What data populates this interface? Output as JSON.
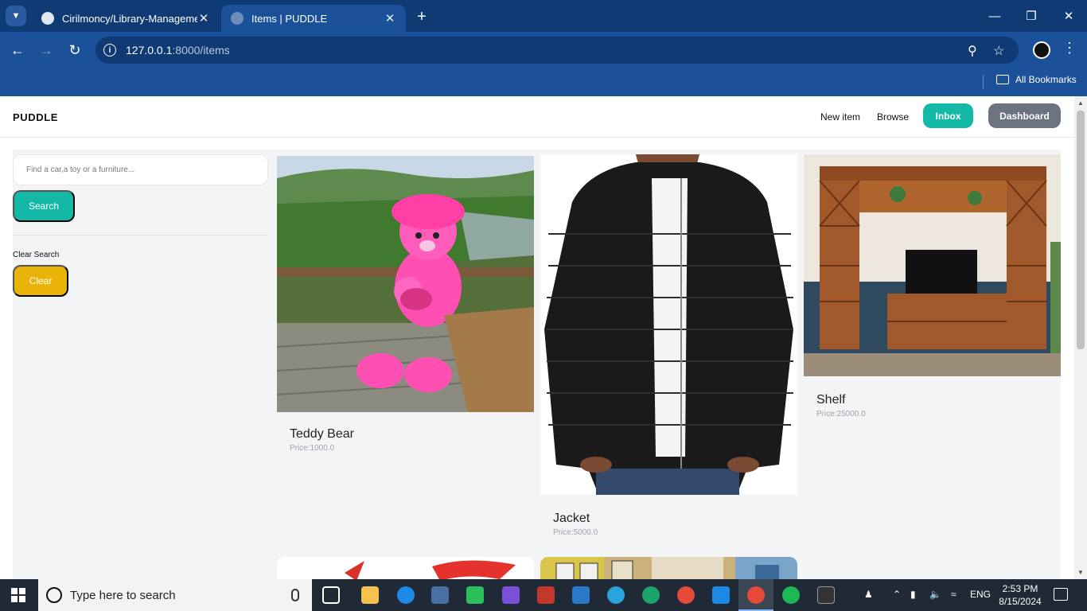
{
  "browser": {
    "tabs": [
      {
        "title": "Cirilmoncy/Library-Management",
        "active": false
      },
      {
        "title": "Items | PUDDLE",
        "active": true
      }
    ],
    "url_host": "127.0.0.1",
    "url_path": ":8000/items",
    "bookmarks_label": "All Bookmarks"
  },
  "navbar": {
    "brand": "PUDDLE",
    "new_item": "New item",
    "browse": "Browse",
    "inbox": "Inbox",
    "dashboard": "Dashboard"
  },
  "sidebar": {
    "search_placeholder": "Find a car,a toy or a furniture...",
    "search_button": "Search",
    "clear_label": "Clear Search",
    "clear_button": "Clear"
  },
  "items": [
    {
      "name": "Teddy Bear",
      "price": "Price:1000.0"
    },
    {
      "name": "Jacket",
      "price": "Price:5000.0"
    },
    {
      "name": "Shelf",
      "price": "Price:25000.0"
    }
  ],
  "taskbar": {
    "search_text": "Type here to search",
    "language": "ENG",
    "time": "2:53 PM",
    "date": "8/15/2024"
  },
  "colors": {
    "accent_teal": "#14b8a6",
    "dashboard_gray": "#6b7280",
    "clear_yellow": "#eab308",
    "chrome_blue": "#1b5199"
  }
}
